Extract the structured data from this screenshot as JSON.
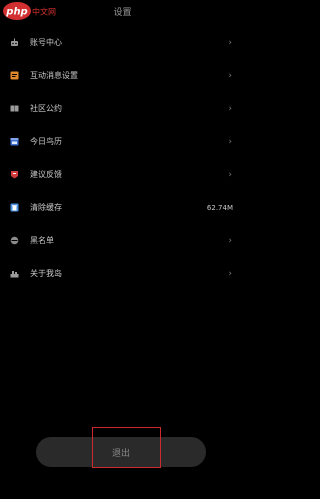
{
  "header": {
    "title": "设置",
    "logo_text": "php 中文网"
  },
  "items": [
    {
      "label": "账号中心",
      "icon": "robot-icon",
      "icon_color": "#9b9b9b",
      "value": "",
      "chevron": "›"
    },
    {
      "label": "互动消息设置",
      "icon": "message-icon",
      "icon_color": "#e08a2c",
      "value": "",
      "chevron": "›"
    },
    {
      "label": "社区公约",
      "icon": "book-icon",
      "icon_color": "#9b9b9b",
      "value": "",
      "chevron": "›"
    },
    {
      "label": "今日鸟历",
      "icon": "calendar-icon",
      "icon_color": "#3f6fd0",
      "value": "",
      "chevron": "›"
    },
    {
      "label": "建议反馈",
      "icon": "feedback-icon",
      "icon_color": "#d23b3b",
      "value": "",
      "chevron": "›"
    },
    {
      "label": "清除缓存",
      "icon": "trash-icon",
      "icon_color": "#4a8fe0",
      "value": "62.74M",
      "chevron": ""
    },
    {
      "label": "黑名单",
      "icon": "blacklist-icon",
      "icon_color": "#8a8a8a",
      "value": "",
      "chevron": "›"
    },
    {
      "label": "关于我岛",
      "icon": "island-icon",
      "icon_color": "#9b9b9b",
      "value": "",
      "chevron": "›"
    }
  ],
  "logout": {
    "label": "退出"
  },
  "colors": {
    "background": "#000000",
    "highlight": "#cc2b2b",
    "button_bg": "#2a2a2a"
  }
}
